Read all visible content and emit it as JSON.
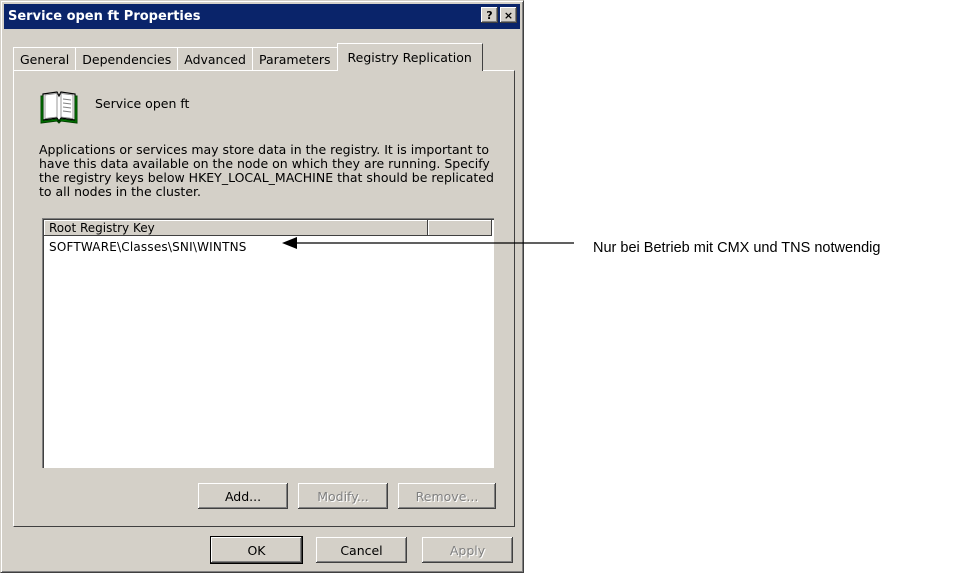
{
  "window": {
    "title": "Service open ft  Properties",
    "help_btn": "?",
    "close_btn": "×"
  },
  "tabs": [
    {
      "label": "General",
      "active": false
    },
    {
      "label": "Dependencies",
      "active": false
    },
    {
      "label": "Advanced",
      "active": false
    },
    {
      "label": "Parameters",
      "active": false
    },
    {
      "label": "Registry Replication",
      "active": true
    }
  ],
  "service": {
    "icon": "book-icon",
    "name": "Service open ft"
  },
  "description": "Applications or services may store data in the registry. It is important to have this data available on the node on which they are running. Specify the registry keys below HKEY_LOCAL_MACHINE that should be replicated to all nodes in the cluster.",
  "list": {
    "columns": [
      "Root Registry Key",
      ""
    ],
    "rows": [
      "SOFTWARE\\Classes\\SNI\\WINTNS"
    ]
  },
  "list_buttons": {
    "add": "Add...",
    "modify": "Modify...",
    "remove": "Remove..."
  },
  "dialog_buttons": {
    "ok": "OK",
    "cancel": "Cancel",
    "apply": "Apply"
  },
  "annotation": {
    "text": "Nur bei Betrieb mit CMX und TNS notwendig"
  }
}
